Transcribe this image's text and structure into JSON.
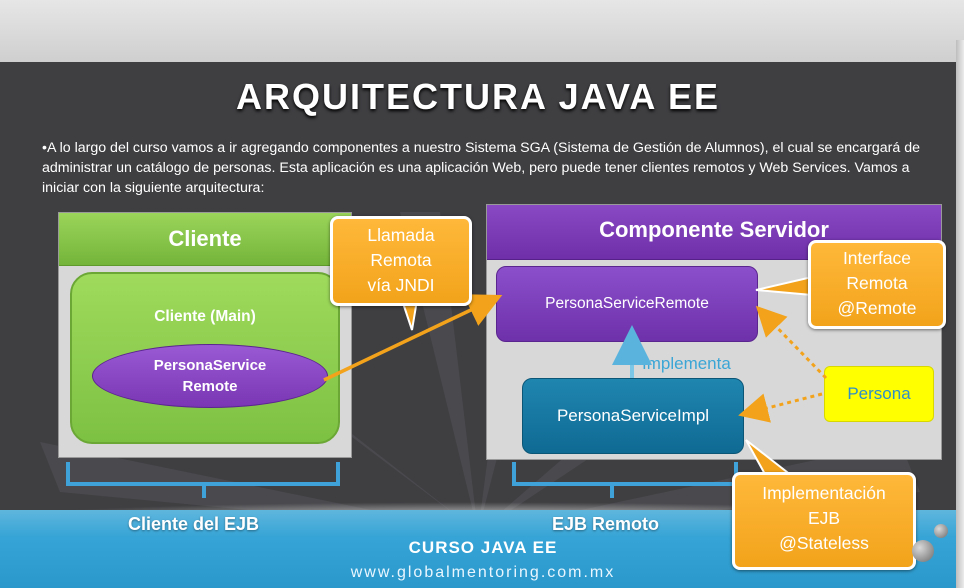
{
  "slide": {
    "title": "ARQUITECTURA JAVA EE",
    "intro": "•A lo largo del curso vamos a ir agregando componentes a nuestro Sistema SGA (Sistema de Gestión de Alumnos), el cual se encargará de administrar un catálogo de personas. Esta aplicación es una aplicación Web, pero puede tener clientes remotos y Web Services. Vamos a iniciar con la siguiente arquitectura:"
  },
  "client": {
    "header": "Cliente",
    "main_label": "Cliente (Main)",
    "interface_line1": "PersonaService",
    "interface_line2": "Remote",
    "bottom_label": "Cliente del EJB"
  },
  "server": {
    "header": "Componente Servidor",
    "remote_interface": "PersonaServiceRemote",
    "implementa_label": "Implementa",
    "impl": "PersonaServiceImpl",
    "persona": "Persona",
    "bottom_label": "EJB Remoto"
  },
  "callouts": {
    "llamada": [
      "Llamada",
      "Remota",
      "vía JNDI"
    ],
    "interface": [
      "Interface",
      "Remota",
      "@Remote"
    ],
    "implementacion": [
      "Implementación",
      "EJB",
      "@Stateless"
    ]
  },
  "footer": {
    "course": "CURSO JAVA EE",
    "url": "www.globalmentoring.com.mx"
  },
  "colors": {
    "background": "#3f3f42",
    "client_green": "#8cc84b",
    "server_purple": "#7a36b4",
    "impl_blue": "#1477a2",
    "callout_orange": "#f7ab25",
    "arrow_orange": "#f2a31b",
    "persona_yellow": "#ffff00",
    "bracket_blue": "#3fa3d9"
  }
}
